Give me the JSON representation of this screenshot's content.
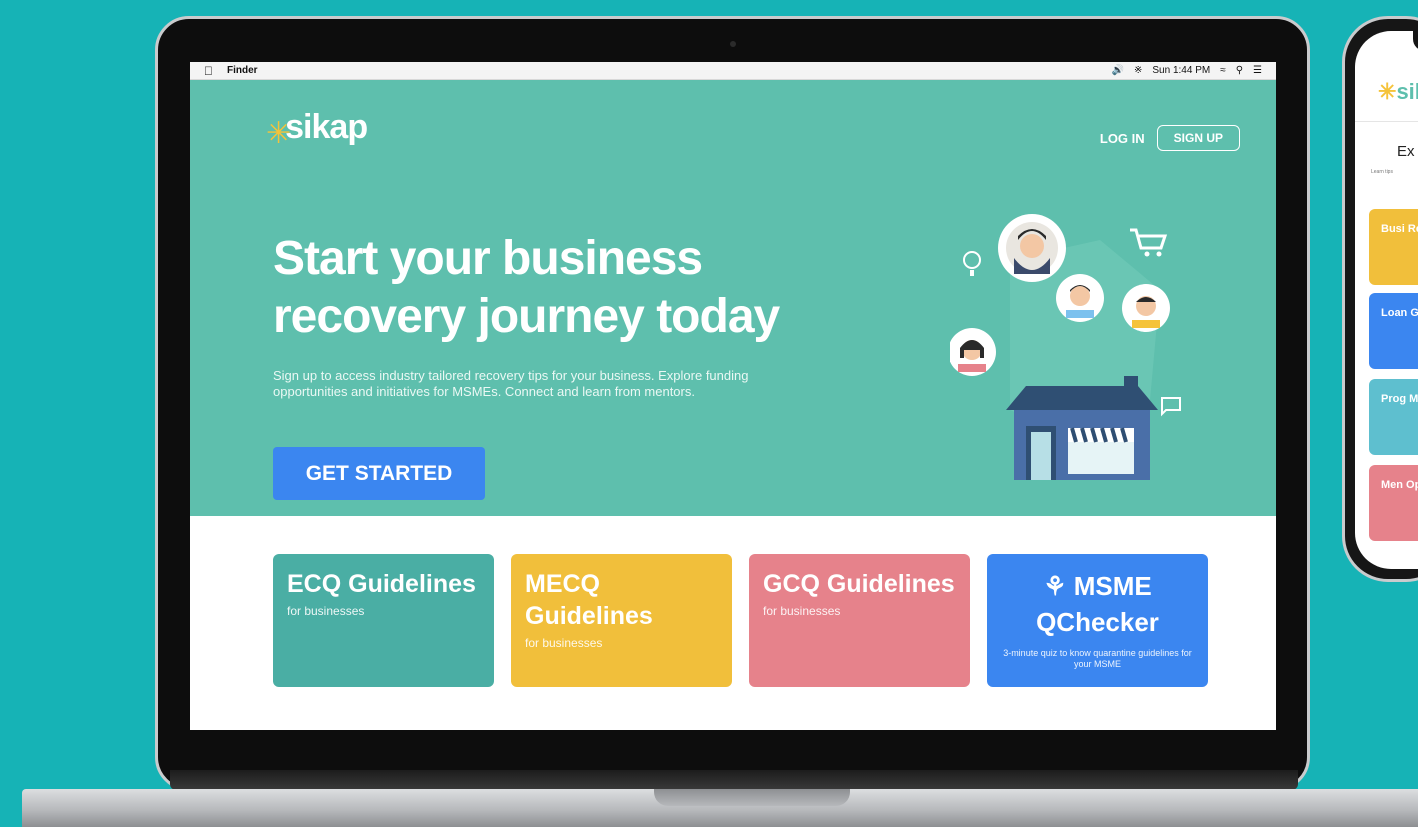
{
  "menubar": {
    "app": "Finder",
    "status": "Sun 1:44 PM"
  },
  "brand": {
    "name": "sikap"
  },
  "nav": {
    "login": "LOG IN",
    "signup": "SIGN UP"
  },
  "hero": {
    "title": "Start your business recovery journey today",
    "description": "Sign up to access industry tailored recovery tips for your business. Explore funding opportunities and initiatives for MSMEs. Connect and learn from mentors.",
    "cta": "GET STARTED"
  },
  "cards": [
    {
      "title": "ECQ Guidelines",
      "subtitle": "for businesses"
    },
    {
      "title": "MECQ Guidelines",
      "subtitle": "for businesses"
    },
    {
      "title": "GCQ Guidelines",
      "subtitle": "for businesses"
    },
    {
      "title": "MSME QChecker",
      "subtitle": "3-minute quiz to know quarantine guidelines for your MSME"
    }
  ],
  "phone": {
    "brand": "sika",
    "title": "Ex",
    "caption": "Learn tips",
    "cards": [
      "Busi Reco",
      "Loan Gran",
      "Prog MSM",
      "Men Oppo"
    ]
  },
  "colors": {
    "background": "#16b3b6",
    "hero": "#5ebfad",
    "primary": "#3b86f0",
    "yellow": "#f1bf3b",
    "pink": "#e6828b"
  }
}
